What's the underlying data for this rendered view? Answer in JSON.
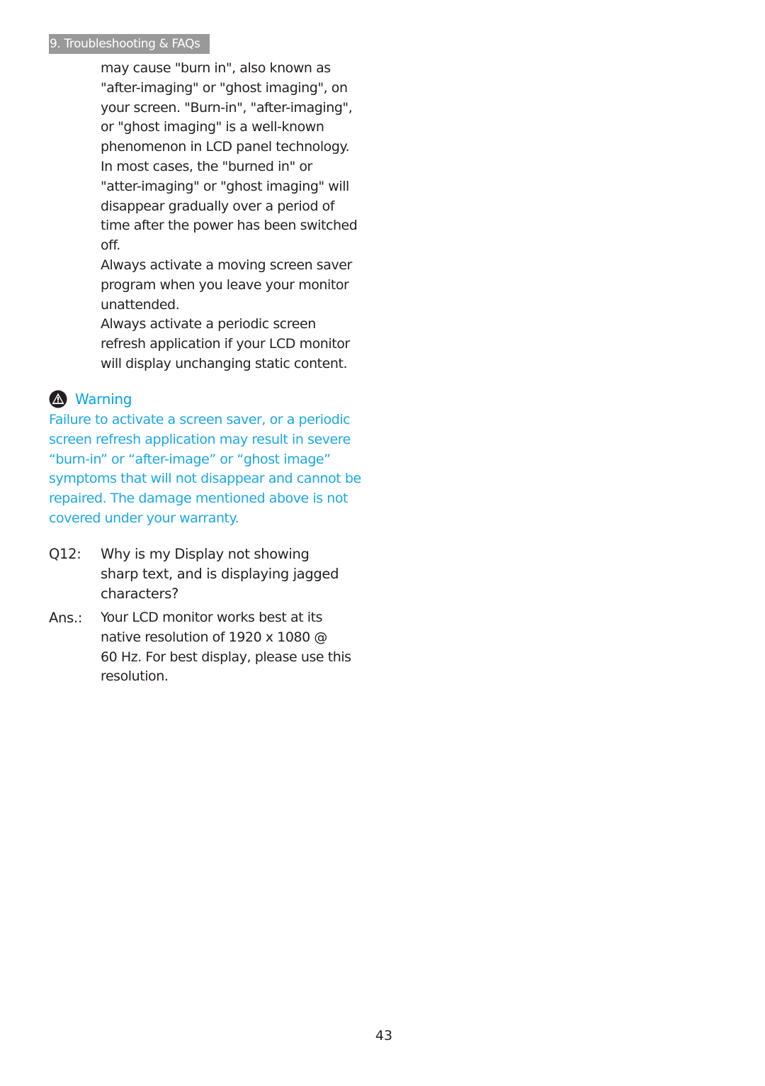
{
  "header": {
    "section_label": "9. Troubleshooting & FAQs"
  },
  "intro_lines": [
    "may cause \"burn in\", also known as",
    "\"after-imaging\" or \"ghost imaging\", on",
    "your screen. \"Burn-in\", \"after-imaging\",",
    "or \"ghost imaging\" is a well-known",
    "phenomenon in LCD panel technology.",
    "In most cases, the \"burned in\" or",
    "\"atter-imaging\" or \"ghost imaging\" will",
    "disappear gradually over a period of",
    "time after the power has been switched",
    "off."
  ],
  "tip1_lines": [
    "Always activate a moving screen saver",
    "program when you leave your monitor",
    "unattended."
  ],
  "tip2_lines": [
    "Always activate a periodic screen",
    "refresh application if your LCD monitor",
    "will display unchanging static content."
  ],
  "warning": {
    "icon": "warning-triangle-icon",
    "title": "Warning",
    "color": "#00a3e8",
    "lines": [
      "Failure to activate a screen saver, or a periodic",
      "screen refresh application may result in severe",
      "“burn-in” or “after-image” or “ghost image”",
      "symptoms that will not disappear and cannot be",
      "repaired. The damage mentioned above is not",
      "covered under your warranty."
    ]
  },
  "faq": {
    "question_label": "Q12:",
    "question_lines": [
      "Why is my Display not showing",
      "sharp text, and is displaying jagged",
      "characters?"
    ],
    "answer_label": "Ans.:",
    "answer_lines": [
      "Your LCD monitor works best at its",
      "native resolution of 1920 x 1080 @",
      "60 Hz. For best display, please use this",
      "resolution."
    ]
  },
  "footer": {
    "page_number": "43"
  }
}
